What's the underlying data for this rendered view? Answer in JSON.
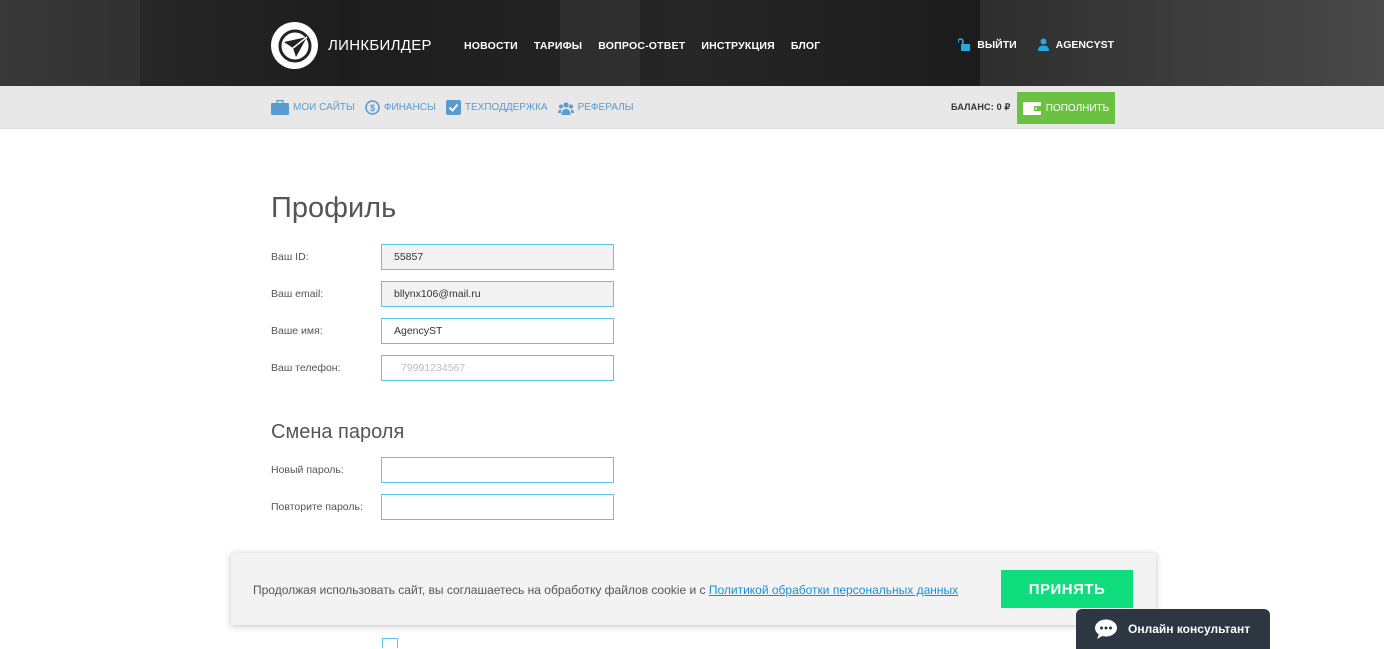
{
  "brand": {
    "name": "ЛИНКБИЛДЕР",
    "logo_icon": "paper-plane-logo-icon"
  },
  "main_nav": [
    {
      "label": "НОВОСТИ"
    },
    {
      "label": "ТАРИФЫ"
    },
    {
      "label": "ВОПРОС-ОТВЕТ"
    },
    {
      "label": "ИНСТРУКЦИЯ"
    },
    {
      "label": "БЛОГ"
    }
  ],
  "user_menu": {
    "logout_label": "ВЫЙТИ",
    "username": "AGENCYST",
    "icon_color": "#29a8e0"
  },
  "sub_nav": [
    {
      "label": "МОИ САЙТЫ",
      "icon": "briefcase-icon"
    },
    {
      "label": "ФИНАНСЫ",
      "icon": "dollar-icon"
    },
    {
      "label": "ТЕХПОДДЕРЖКА",
      "icon": "check-box-icon"
    },
    {
      "label": "РЕФЕРАЛЫ",
      "icon": "users-icon"
    }
  ],
  "balance": {
    "label": "БАЛАНС: 0 ₽",
    "topup_label": "ПОПОЛНИТЬ",
    "topup_color": "#6bc141"
  },
  "profile": {
    "title": "Профиль",
    "fields": {
      "id": {
        "label": "Ваш ID:",
        "value": "55857"
      },
      "email": {
        "label": "Ваш email:",
        "value": "bllynx106@mail.ru"
      },
      "name": {
        "label": "Ваше имя:",
        "value": "AgencyST"
      },
      "phone": {
        "label": "Ваш телефон:",
        "value": "+",
        "placeholder": "79991234567"
      }
    }
  },
  "password": {
    "title": "Смена пароля",
    "new_label": "Новый пароль:",
    "repeat_label": "Повторите пароль:"
  },
  "cookie": {
    "text": "Продолжая использовать сайт, вы соглашаетесь на обработку файлов cookie и с ",
    "link_text": "Политикой обработки персональных данных",
    "accept_label": "ПРИНЯТЬ",
    "accept_color": "#0fdc7c"
  },
  "chat": {
    "label": "Онлайн консультант"
  }
}
